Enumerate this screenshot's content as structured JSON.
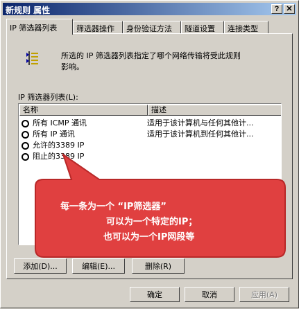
{
  "window": {
    "title": "新规则 属性",
    "help_button": "?",
    "close_button": "✕"
  },
  "tabs": [
    {
      "label": "IP 筛选器列表",
      "active": true
    },
    {
      "label": "筛选器操作"
    },
    {
      "label": "身份验证方法"
    },
    {
      "label": "隧道设置"
    },
    {
      "label": "连接类型"
    }
  ],
  "panel": {
    "icon": "filter-list-icon",
    "description_line1": "所选的 IP 筛选器列表指定了哪个网络传输将受此规则",
    "description_line2": "影响。",
    "list_label": "IP 筛选器列表(L):"
  },
  "listview": {
    "columns": [
      "名称",
      "描述"
    ],
    "rows": [
      {
        "name": "所有 ICMP 通讯",
        "desc": "适用于该计算机与任何其他计..."
      },
      {
        "name": "所有 IP 通讯",
        "desc": "适用于该计算机到任何其他计..."
      },
      {
        "name": "允许的3389 IP",
        "desc": ""
      },
      {
        "name": "阻止的3389 IP",
        "desc": ""
      }
    ]
  },
  "callout": {
    "line1": "每一条为一个 “IP筛选器”",
    "line2": "可以为一个特定的IP；",
    "line3": "也可以为一个IP网段等",
    "fill_color": "#e04040",
    "border_color": "#b82828"
  },
  "panel_buttons": {
    "add": "添加(D)...",
    "edit": "编辑(E)...",
    "delete": "删除(R)"
  },
  "dialog_buttons": {
    "ok": "确定",
    "cancel": "取消",
    "apply": "应用(A)"
  }
}
